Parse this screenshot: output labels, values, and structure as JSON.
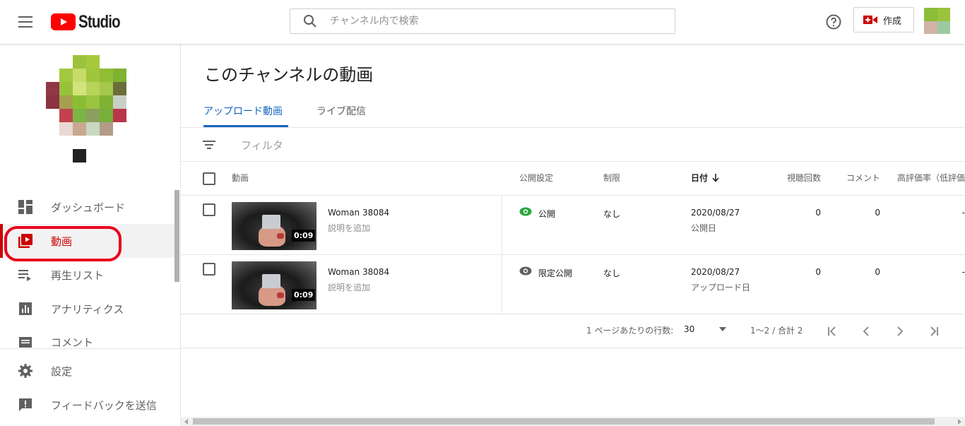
{
  "header": {
    "logo_text": "Studio",
    "search_placeholder": "チャンネル内で検索",
    "create_label": "作成"
  },
  "sidebar": {
    "items": [
      {
        "label": "ダッシュボード",
        "icon": "dashboard-icon"
      },
      {
        "label": "動画",
        "icon": "video-library-icon",
        "active": true
      },
      {
        "label": "再生リスト",
        "icon": "playlist-icon"
      },
      {
        "label": "アナリティクス",
        "icon": "analytics-icon"
      },
      {
        "label": "コメント",
        "icon": "comment-icon"
      }
    ],
    "bottom_items": [
      {
        "label": "設定",
        "icon": "gear-icon"
      },
      {
        "label": "フィードバックを送信",
        "icon": "feedback-icon"
      }
    ]
  },
  "main": {
    "title": "このチャンネルの動画",
    "tabs": [
      {
        "label": "アップロード動画",
        "active": true
      },
      {
        "label": "ライブ配信"
      }
    ],
    "filter_label": "フィルタ",
    "columns": {
      "video": "動画",
      "visibility": "公開設定",
      "restriction": "制限",
      "date": "日付",
      "views": "視聴回数",
      "comments": "コメント",
      "likes": "高評価率（低評価"
    },
    "rows": [
      {
        "title": "Woman 38084",
        "description": "説明を追加",
        "duration": "0:09",
        "visibility": "公開",
        "visibility_color": "#2ba640",
        "restriction": "なし",
        "date": "2020/08/27",
        "date_sub": "公開日",
        "views": "0",
        "comments": "0",
        "likes": "-"
      },
      {
        "title": "Woman 38084",
        "description": "説明を追加",
        "duration": "0:09",
        "visibility": "限定公開",
        "visibility_color": "#606060",
        "restriction": "なし",
        "date": "2020/08/27",
        "date_sub": "アップロード日",
        "views": "0",
        "comments": "0",
        "likes": "-"
      }
    ],
    "pagination": {
      "rows_per_page_label": "1 ページあたりの行数:",
      "rows_per_page": "30",
      "range": "1～2 / 合計 2"
    }
  },
  "colors": {
    "accent_blue": "#1565c0",
    "active_red": "#cc0000",
    "highlight_ring": "#e8001c",
    "youtube_red": "#ff0000"
  }
}
